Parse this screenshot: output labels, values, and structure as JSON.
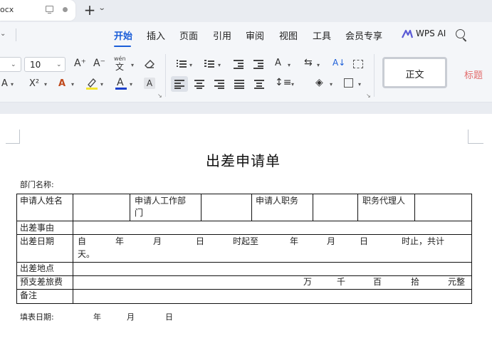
{
  "titlebar": {
    "doc_tab_label": "ocx",
    "new_tab": "+",
    "tab_dropdown": "⌄"
  },
  "menu": {
    "left_chevron": "⌄",
    "items": [
      "开始",
      "插入",
      "页面",
      "引用",
      "审阅",
      "视图",
      "工具",
      "会员专享"
    ],
    "active_index": 0,
    "wps_ai": "WPS AI",
    "accent_color": "#1a5dd8"
  },
  "ribbon": {
    "font_size": "10",
    "increase_font": "A⁺",
    "decrease_font": "A⁻",
    "pinyin": "wén",
    "superscript": "X²",
    "font_color": "#1a3fcc",
    "highlight_color": "#f4e52b",
    "styles": {
      "normal": "正文",
      "heading": "标题"
    }
  },
  "document": {
    "title": "出差申请单",
    "department_label": "部门名称:",
    "fill_date_label": "填表日期:",
    "fill_date_parts": [
      "年",
      "月",
      "日"
    ],
    "table": {
      "row1": {
        "applicant_name": "申请人姓名",
        "applicant_dept_line1": "申请人工作部",
        "applicant_dept_line2": "门",
        "applicant_position": "申请人职务",
        "proxy": "职务代理人"
      },
      "reason": "出差事由",
      "date_label": "出差日期",
      "date_line1": [
        "自",
        "年",
        "月",
        "日",
        "时起至",
        "年",
        "月",
        "日",
        "时止，共计"
      ],
      "date_line2": "天。",
      "location": "出差地点",
      "advance_label": "预支差旅费",
      "advance_units": [
        "万",
        "千",
        "百",
        "拾",
        "元整"
      ],
      "remarks": "备注"
    }
  }
}
